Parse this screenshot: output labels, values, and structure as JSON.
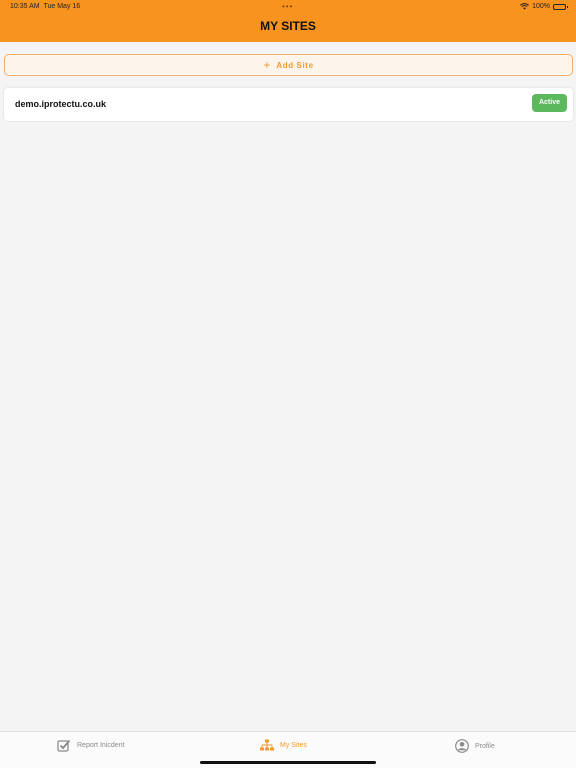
{
  "status": {
    "time": "10:35 AM",
    "date": "Tue May 16",
    "battery": "100%"
  },
  "header": {
    "title": "MY SITES"
  },
  "actions": {
    "add_site_label": "Add Site"
  },
  "sites": [
    {
      "name": "demo.iprotectu.co.uk",
      "status": "Active"
    }
  ],
  "tabs": [
    {
      "label": "Report Inicdent",
      "icon": "checkbox-icon",
      "active": false
    },
    {
      "label": "My Sites",
      "icon": "sitemap-icon",
      "active": true
    },
    {
      "label": "Profile",
      "icon": "user-icon",
      "active": false
    }
  ],
  "colors": {
    "accent": "#f7931e",
    "active_badge": "#5cb85c",
    "background": "#f4f4f4"
  }
}
